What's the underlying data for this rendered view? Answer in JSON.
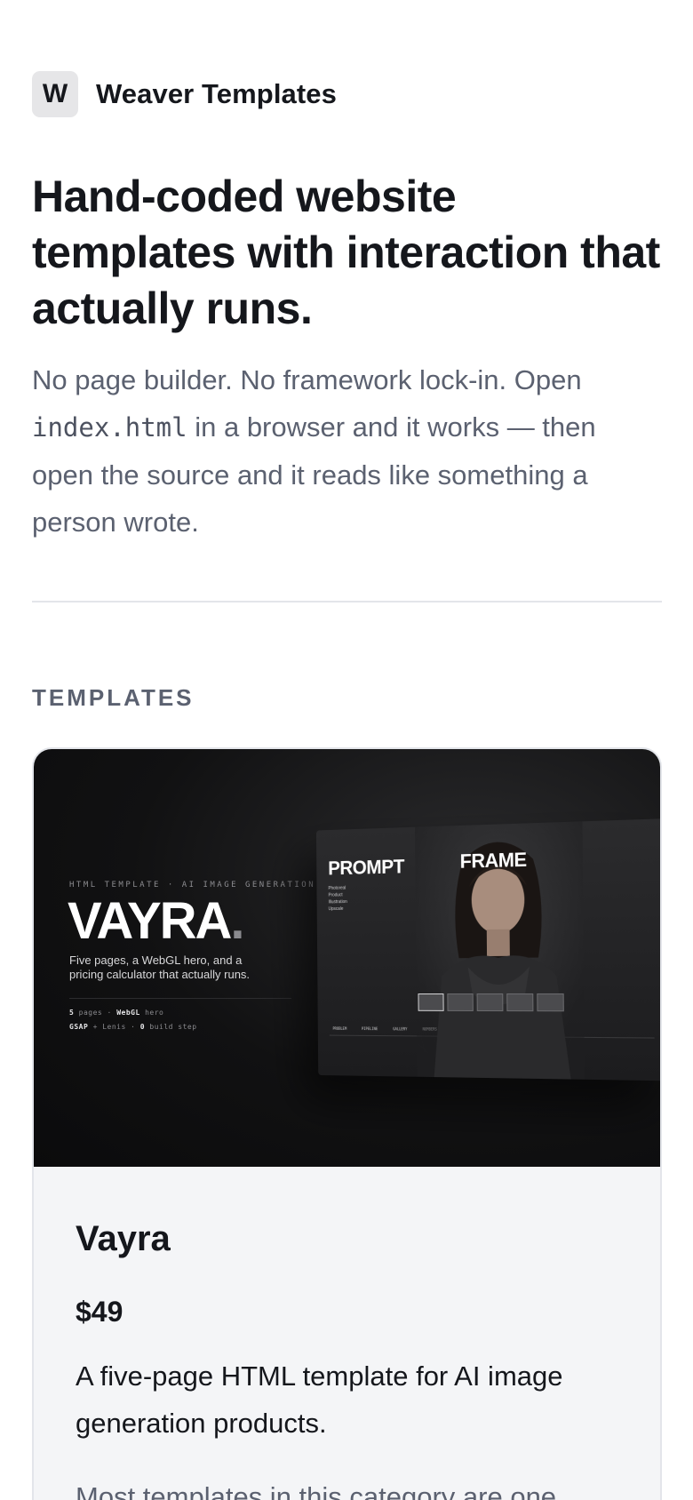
{
  "brand": {
    "logo_letter": "W",
    "name": "Weaver Templates"
  },
  "hero": {
    "title": "Hand-coded website templates with interaction that actually runs.",
    "subtitle_part1": "No page builder. No framework lock-in. Open ",
    "subtitle_code": "index.html",
    "subtitle_part2": " in a browser and it works — then open the source and it reads like something a person wrote."
  },
  "section": {
    "label": "TEMPLATES"
  },
  "card": {
    "preview": {
      "eyebrow": "HTML TEMPLATE · AI IMAGE GENERATION",
      "logo": "VAYRA",
      "logo_dot": ".",
      "tagline": "Five pages, a WebGL hero, and a pricing calculator that actually runs.",
      "stat1_num": "5",
      "stat1_text": " pages · ",
      "stat1_bold": "WebGL",
      "stat1_end": " hero",
      "stat2_bold": "GSAP",
      "stat2_text": " + Lenis · ",
      "stat2_num": "0",
      "stat2_end": " build step",
      "screen": {
        "left_word": "PROMPT",
        "right_word": "FRAME",
        "menu": [
          "Photoreal",
          "Product",
          "Illustration",
          "Upscale"
        ],
        "nav": [
          "PROBLEM",
          "PIPELINE",
          "GALLERY",
          "NUMBERS",
          "PRICING"
        ]
      }
    },
    "title": "Vayra",
    "price": "$49",
    "description": "A five-page HTML template for AI image generation products.",
    "description_more": "Most templates in this category are one"
  },
  "colors": {
    "text": "#15171c",
    "muted": "#5b6170",
    "card_bg": "#f4f5f7",
    "border": "#e3e5ea",
    "preview_bg": "#0b0b0c"
  }
}
